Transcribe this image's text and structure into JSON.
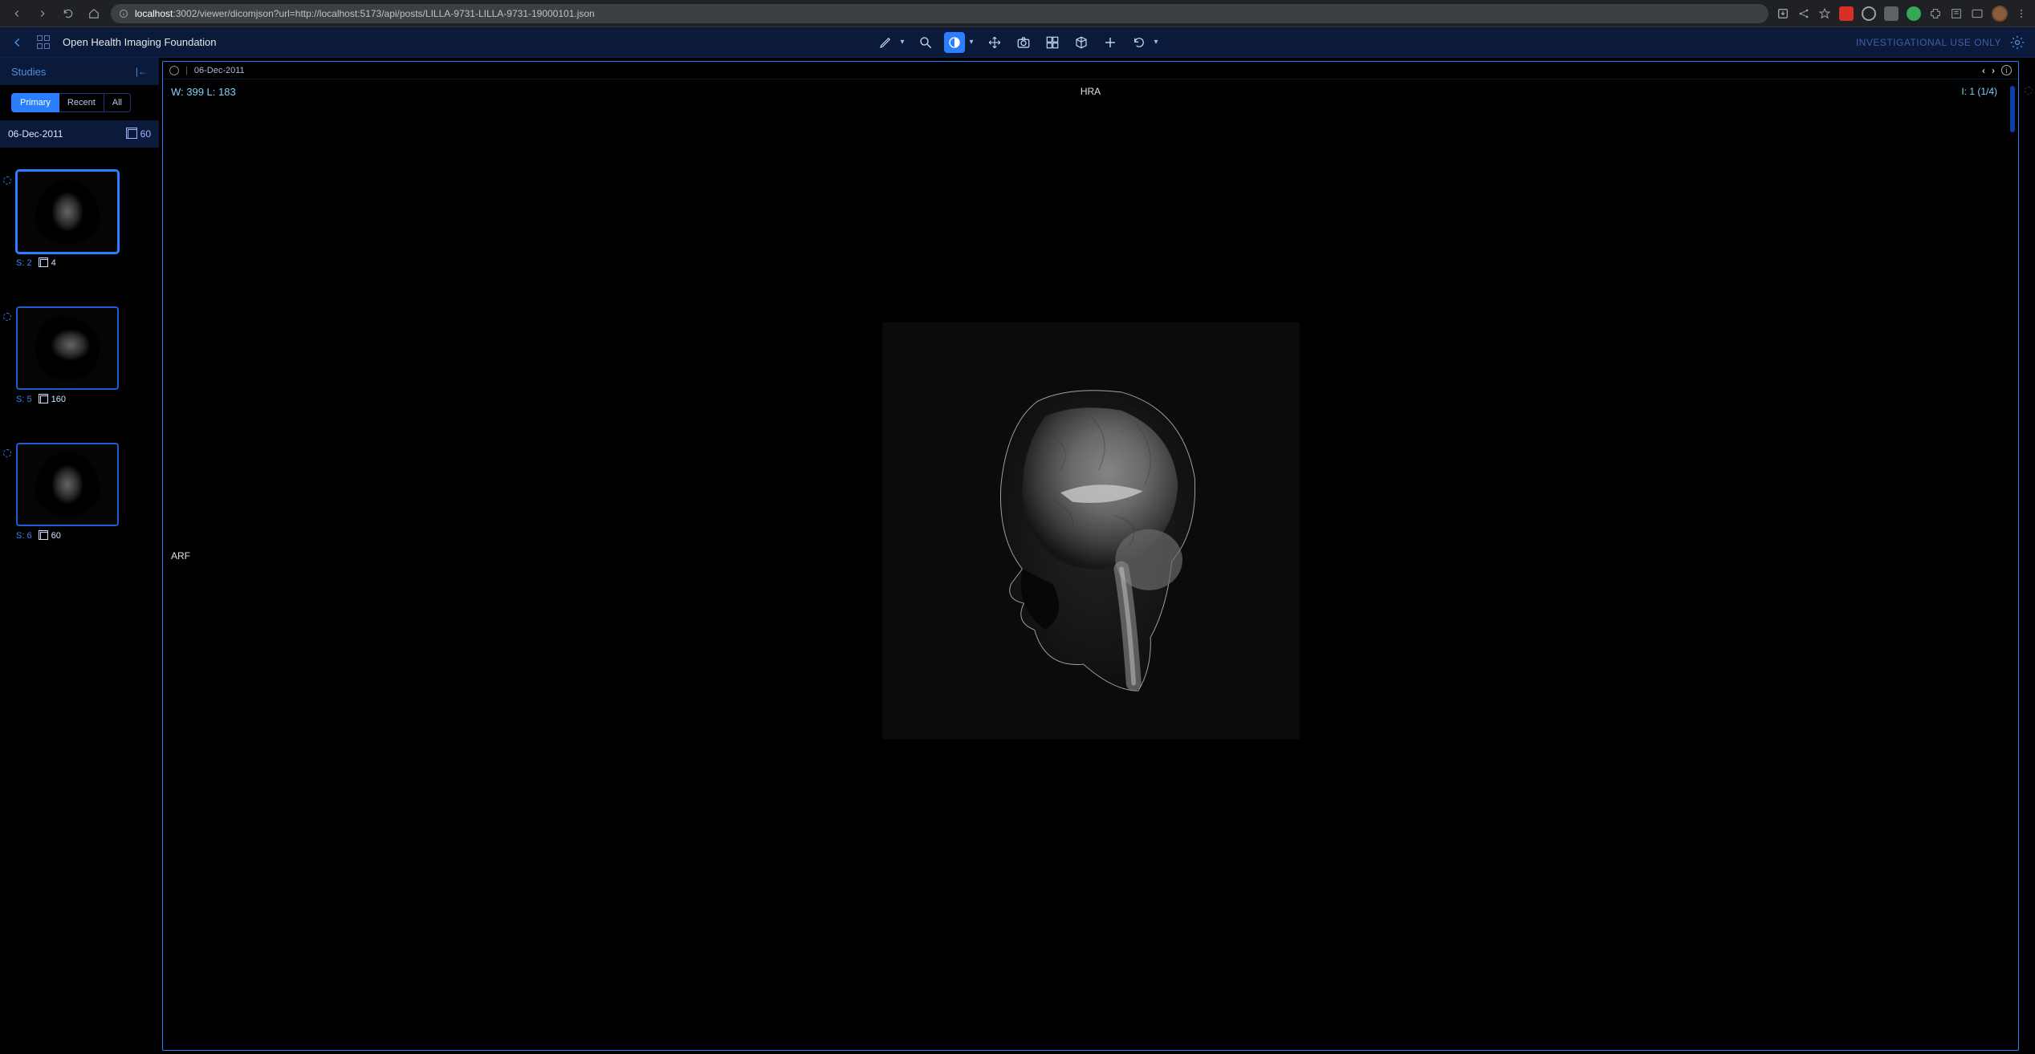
{
  "browser": {
    "url_host": "localhost",
    "url_path": ":3002/viewer/dicomjson?url=http://localhost:5173/api/posts/LILLA-9731-LILLA-9731-19000101.json"
  },
  "header": {
    "brand": "Open Health Imaging Foundation",
    "investigational": "INVESTIGATIONAL USE ONLY",
    "tools": {
      "measure": "measure",
      "zoom": "zoom",
      "windowlevel": "window-level",
      "pan": "pan",
      "capture": "capture",
      "layout": "layout",
      "mpr": "mpr",
      "crosshairs": "crosshairs",
      "reset": "reset"
    }
  },
  "sidebar": {
    "title": "Studies",
    "filters": {
      "primary": "Primary",
      "recent": "Recent",
      "all": "All"
    },
    "study_date": "06-Dec-2011",
    "study_count": "60",
    "series": [
      {
        "s_label": "S:",
        "s_val": "2",
        "count": "4"
      },
      {
        "s_label": "S:",
        "s_val": "5",
        "count": "160"
      },
      {
        "s_label": "S:",
        "s_val": "6",
        "count": "60"
      }
    ]
  },
  "viewport": {
    "header_date": "06-Dec-2011",
    "wl": "W: 399  L: 183",
    "top_center": "HRA",
    "top_right": "I: 1 (1/4)",
    "mid_left": "ARF"
  }
}
